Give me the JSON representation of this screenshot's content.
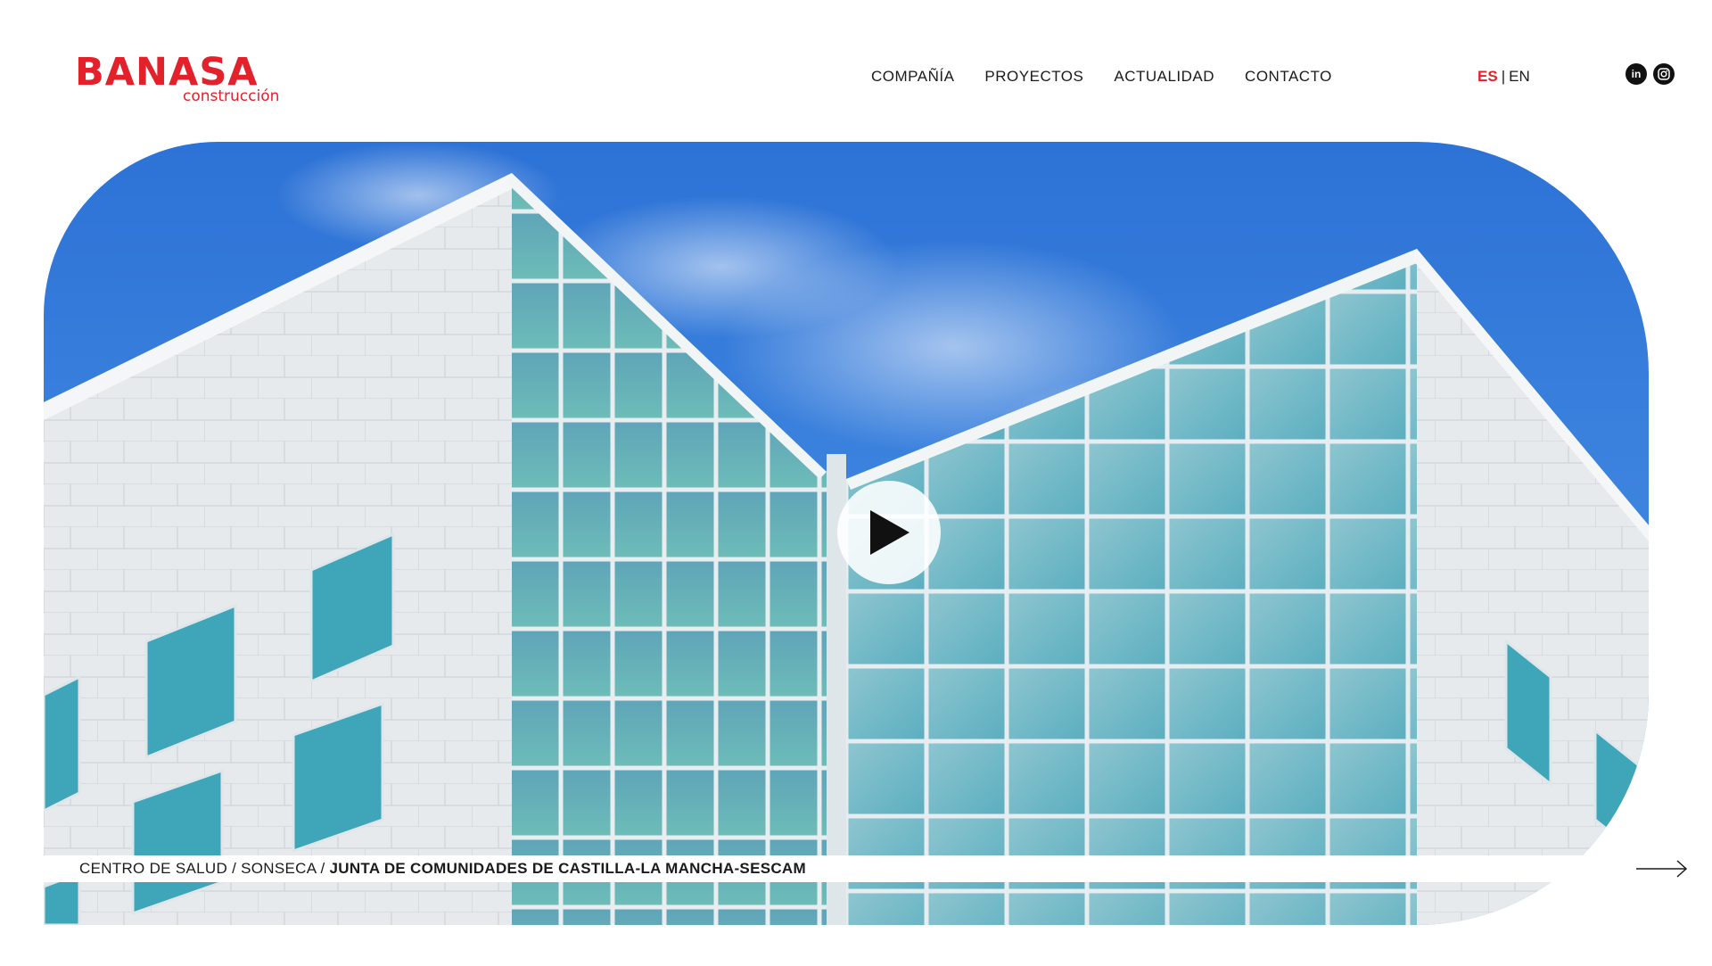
{
  "brand": {
    "name": "BANASA",
    "tagline": "construcción",
    "color": "#e3212b"
  },
  "nav": {
    "items": [
      {
        "label": "COMPAÑÍA"
      },
      {
        "label": "PROYECTOS"
      },
      {
        "label": "ACTUALIDAD"
      },
      {
        "label": "CONTACTO"
      }
    ]
  },
  "language": {
    "active": "ES",
    "separator": "|",
    "other": "EN"
  },
  "social": [
    {
      "icon": "linkedin-icon",
      "label": "in"
    },
    {
      "icon": "instagram-icon"
    }
  ],
  "hero": {
    "play_icon": "play-icon",
    "caption": {
      "type": "CENTRO DE SALUD",
      "sep1": "/",
      "location": "SONSECA",
      "sep2": "/",
      "client": "JUNTA DE COMUNIDADES DE CASTILLA-LA MANCHA-SESCAM"
    },
    "next_icon": "arrow-right-icon"
  }
}
